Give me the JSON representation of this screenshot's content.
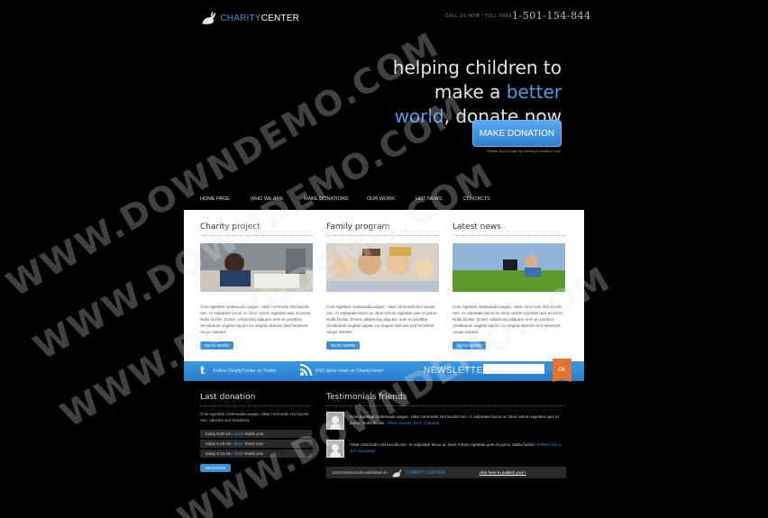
{
  "header": {
    "logo_main": "CHARITY",
    "logo_accent": "CENTER",
    "call_label": "CALL US NOW / TOLL FREE",
    "phone": "1-501-154-844"
  },
  "hero": {
    "line1": "helping children to",
    "line2_a": "make a ",
    "line2_b": "better",
    "line3_a": "world",
    "line3_b": ", donate now",
    "button": "MAKE DONATION",
    "fine_print": "Please stop hunger by making a donation now"
  },
  "nav": {
    "items": [
      "HOME PAGE",
      "WHO WE ARE",
      "MAKE DONATIONS",
      "OUR WORK",
      "HOT NEWS",
      "CONTACTS"
    ]
  },
  "columns": [
    {
      "title": "Charity project",
      "text": "Cras egestas malesuada augue, vitae commodo nisl iaculis non. In vulputate lacus ac risus rutrum egestas quis et purus. Nulla facilisi. Donec adipiscing aliquam ante eu porttitor. Vestibulum sagittis sapien eu magna ultricies sed hendrerit neque laoreet.",
      "more": "READ MORE"
    },
    {
      "title": "Family program",
      "text": "Cras egestas malesuada augue, vitae commodo nisl iaculis non. In vulputate lacus ac risus rutrum egestas quis et purus. Nulla facilisi. Donec adipiscing aliquam ante eu porttitor. Vestibulum sagittis sapien eu magna ultricies sed hendrerit neque laoreet.",
      "more": "READ MORE"
    },
    {
      "title": "Latest news",
      "text": "Cras egestas malesuada augue, vitae commodo nisl iaculis non. In vulputate lacus ac risus rutrum egestas quis et purus. Nulla facilisi. Donec adipiscing aliquam ante eu porttitor. Vestibulum sagittis sapien eu magna ultricies sed hendrerit neque laoreet.",
      "more": "READ MORE"
    }
  ],
  "bar": {
    "follow": "Follow CharityCenter on Twitter",
    "rss": "RSS latest news on CharityCenter",
    "newsletter": "NEWSLETTER",
    "ok": "OK"
  },
  "last_donation": {
    "title": "Last donation",
    "text": "Cras egestas malesuada augue, vitae commodo nisl iaculis non. ultricies sed hendrerit.",
    "rows": [
      {
        "time": "today 6:30 am - ",
        "amount": "$100",
        "suffix": " thank you!"
      },
      {
        "time": "today 5:18 am - ",
        "amount": "$150",
        "suffix": " thank you!"
      },
      {
        "time": "today 4:14 am - ",
        "amount": "$250",
        "suffix": " thank you!"
      }
    ],
    "archives": "ARCHIVES"
  },
  "testimonials": {
    "title": "Testimonials friends",
    "items": [
      {
        "text": "Cras egestas malesuada augue, vitae commodo nisl iaculis non. In vulputate lacus ac risus rutrum egestas quis et purus. Nulla facilisi. ",
        "author": "Alfred Jacobs, NYC, Canada"
      },
      {
        "text": "Vitae commodo nisl iaculis non. In vulputate lacus ac risus rutrum egestas quis et purus. Nulla facilisi. ",
        "author": "Wilfred Cisco, Jim Alexander"
      }
    ],
    "footer_count": "1240 testimonials published on",
    "footer_brand": "CHARITY CENTER",
    "footer_link": "click here to publish your !"
  },
  "watermark": "WWW.DOWNDEMO.COM",
  "colors": {
    "accent": "#3d8fd6",
    "bar": "#2f88d8",
    "ok": "#e2722d"
  }
}
